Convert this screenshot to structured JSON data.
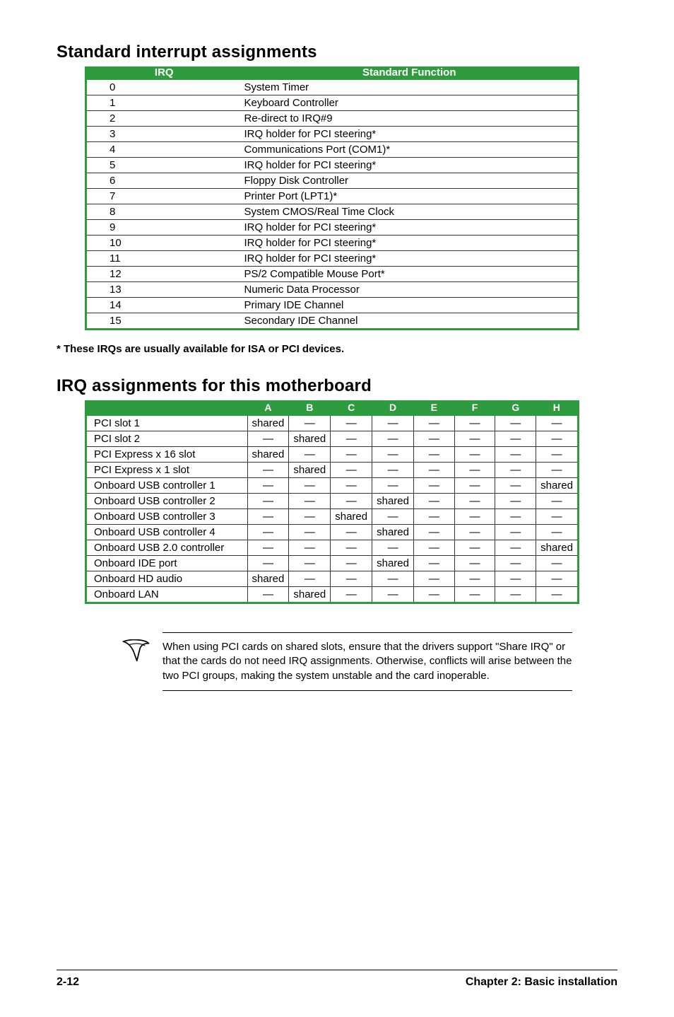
{
  "section1": {
    "title": "Standard interrupt assignments",
    "headers": {
      "irq": "IRQ",
      "func": "Standard Function"
    },
    "rows": [
      {
        "irq": "0",
        "func": "System Timer"
      },
      {
        "irq": "1",
        "func": "Keyboard Controller"
      },
      {
        "irq": "2",
        "func": "Re-direct to IRQ#9"
      },
      {
        "irq": "3",
        "func": "IRQ holder for PCI steering*"
      },
      {
        "irq": "4",
        "func": "Communications Port (COM1)*"
      },
      {
        "irq": "5",
        "func": "IRQ holder for PCI steering*"
      },
      {
        "irq": "6",
        "func": "Floppy Disk Controller"
      },
      {
        "irq": "7",
        "func": "Printer Port (LPT1)*"
      },
      {
        "irq": "8",
        "func": "System CMOS/Real Time Clock"
      },
      {
        "irq": "9",
        "func": "IRQ holder for PCI steering*"
      },
      {
        "irq": "10",
        "func": "IRQ holder for PCI steering*"
      },
      {
        "irq": "11",
        "func": "IRQ holder for PCI steering*"
      },
      {
        "irq": "12",
        "func": "PS/2 Compatible Mouse Port*"
      },
      {
        "irq": "13",
        "func": "Numeric Data Processor"
      },
      {
        "irq": "14",
        "func": "Primary IDE Channel"
      },
      {
        "irq": "15",
        "func": "Secondary IDE Channel"
      }
    ],
    "footnote": "* These IRQs are usually available for ISA or PCI devices."
  },
  "section2": {
    "title": "IRQ assignments for this motherboard",
    "headers": [
      "",
      "A",
      "B",
      "C",
      "D",
      "E",
      "F",
      "G",
      "H"
    ],
    "rows": [
      {
        "label": "PCI slot 1",
        "cells": [
          "shared",
          "—",
          "—",
          "—",
          "—",
          "—",
          "—",
          "—"
        ]
      },
      {
        "label": "PCI slot 2",
        "cells": [
          "—",
          "shared",
          "—",
          "—",
          "—",
          "—",
          "—",
          "—"
        ]
      },
      {
        "label": "PCI Express x 16 slot",
        "cells": [
          "shared",
          "—",
          "—",
          "—",
          "—",
          "—",
          "—",
          "—"
        ]
      },
      {
        "label": "PCI Express x 1 slot",
        "cells": [
          "—",
          "shared",
          "—",
          "—",
          "—",
          "—",
          "—",
          "—"
        ]
      },
      {
        "label": "Onboard USB controller 1",
        "cells": [
          "—",
          "—",
          "—",
          "—",
          "—",
          "—",
          "—",
          "shared"
        ]
      },
      {
        "label": "Onboard USB controller 2",
        "cells": [
          "—",
          "—",
          "—",
          "shared",
          "—",
          "—",
          "—",
          "—"
        ]
      },
      {
        "label": "Onboard USB controller 3",
        "cells": [
          "—",
          "—",
          "shared",
          "—",
          "—",
          "—",
          "—",
          "—"
        ]
      },
      {
        "label": "Onboard USB controller 4",
        "cells": [
          "—",
          "—",
          "—",
          "shared",
          "—",
          "—",
          "—",
          "—"
        ]
      },
      {
        "label": "Onboard USB 2.0 controller",
        "cells": [
          "—",
          "—",
          "—",
          "—",
          "—",
          "—",
          "—",
          "shared"
        ]
      },
      {
        "label": "Onboard IDE port",
        "cells": [
          "—",
          "—",
          "—",
          "shared",
          "—",
          "—",
          "—",
          "—"
        ]
      },
      {
        "label": "Onboard HD audio",
        "cells": [
          "shared",
          "—",
          "—",
          "—",
          "—",
          "—",
          "—",
          "—"
        ]
      },
      {
        "label": "Onboard LAN",
        "cells": [
          "—",
          "shared",
          "—",
          "—",
          "—",
          "—",
          "—",
          "—"
        ]
      }
    ]
  },
  "note": "When using PCI cards on shared slots, ensure that the drivers support \"Share IRQ\" or that the cards do not need IRQ assignments. Otherwise, conflicts will arise between the two PCI groups, making the system unstable and the card inoperable.",
  "footer": {
    "left": "2-12",
    "right": "Chapter 2: Basic installation"
  }
}
